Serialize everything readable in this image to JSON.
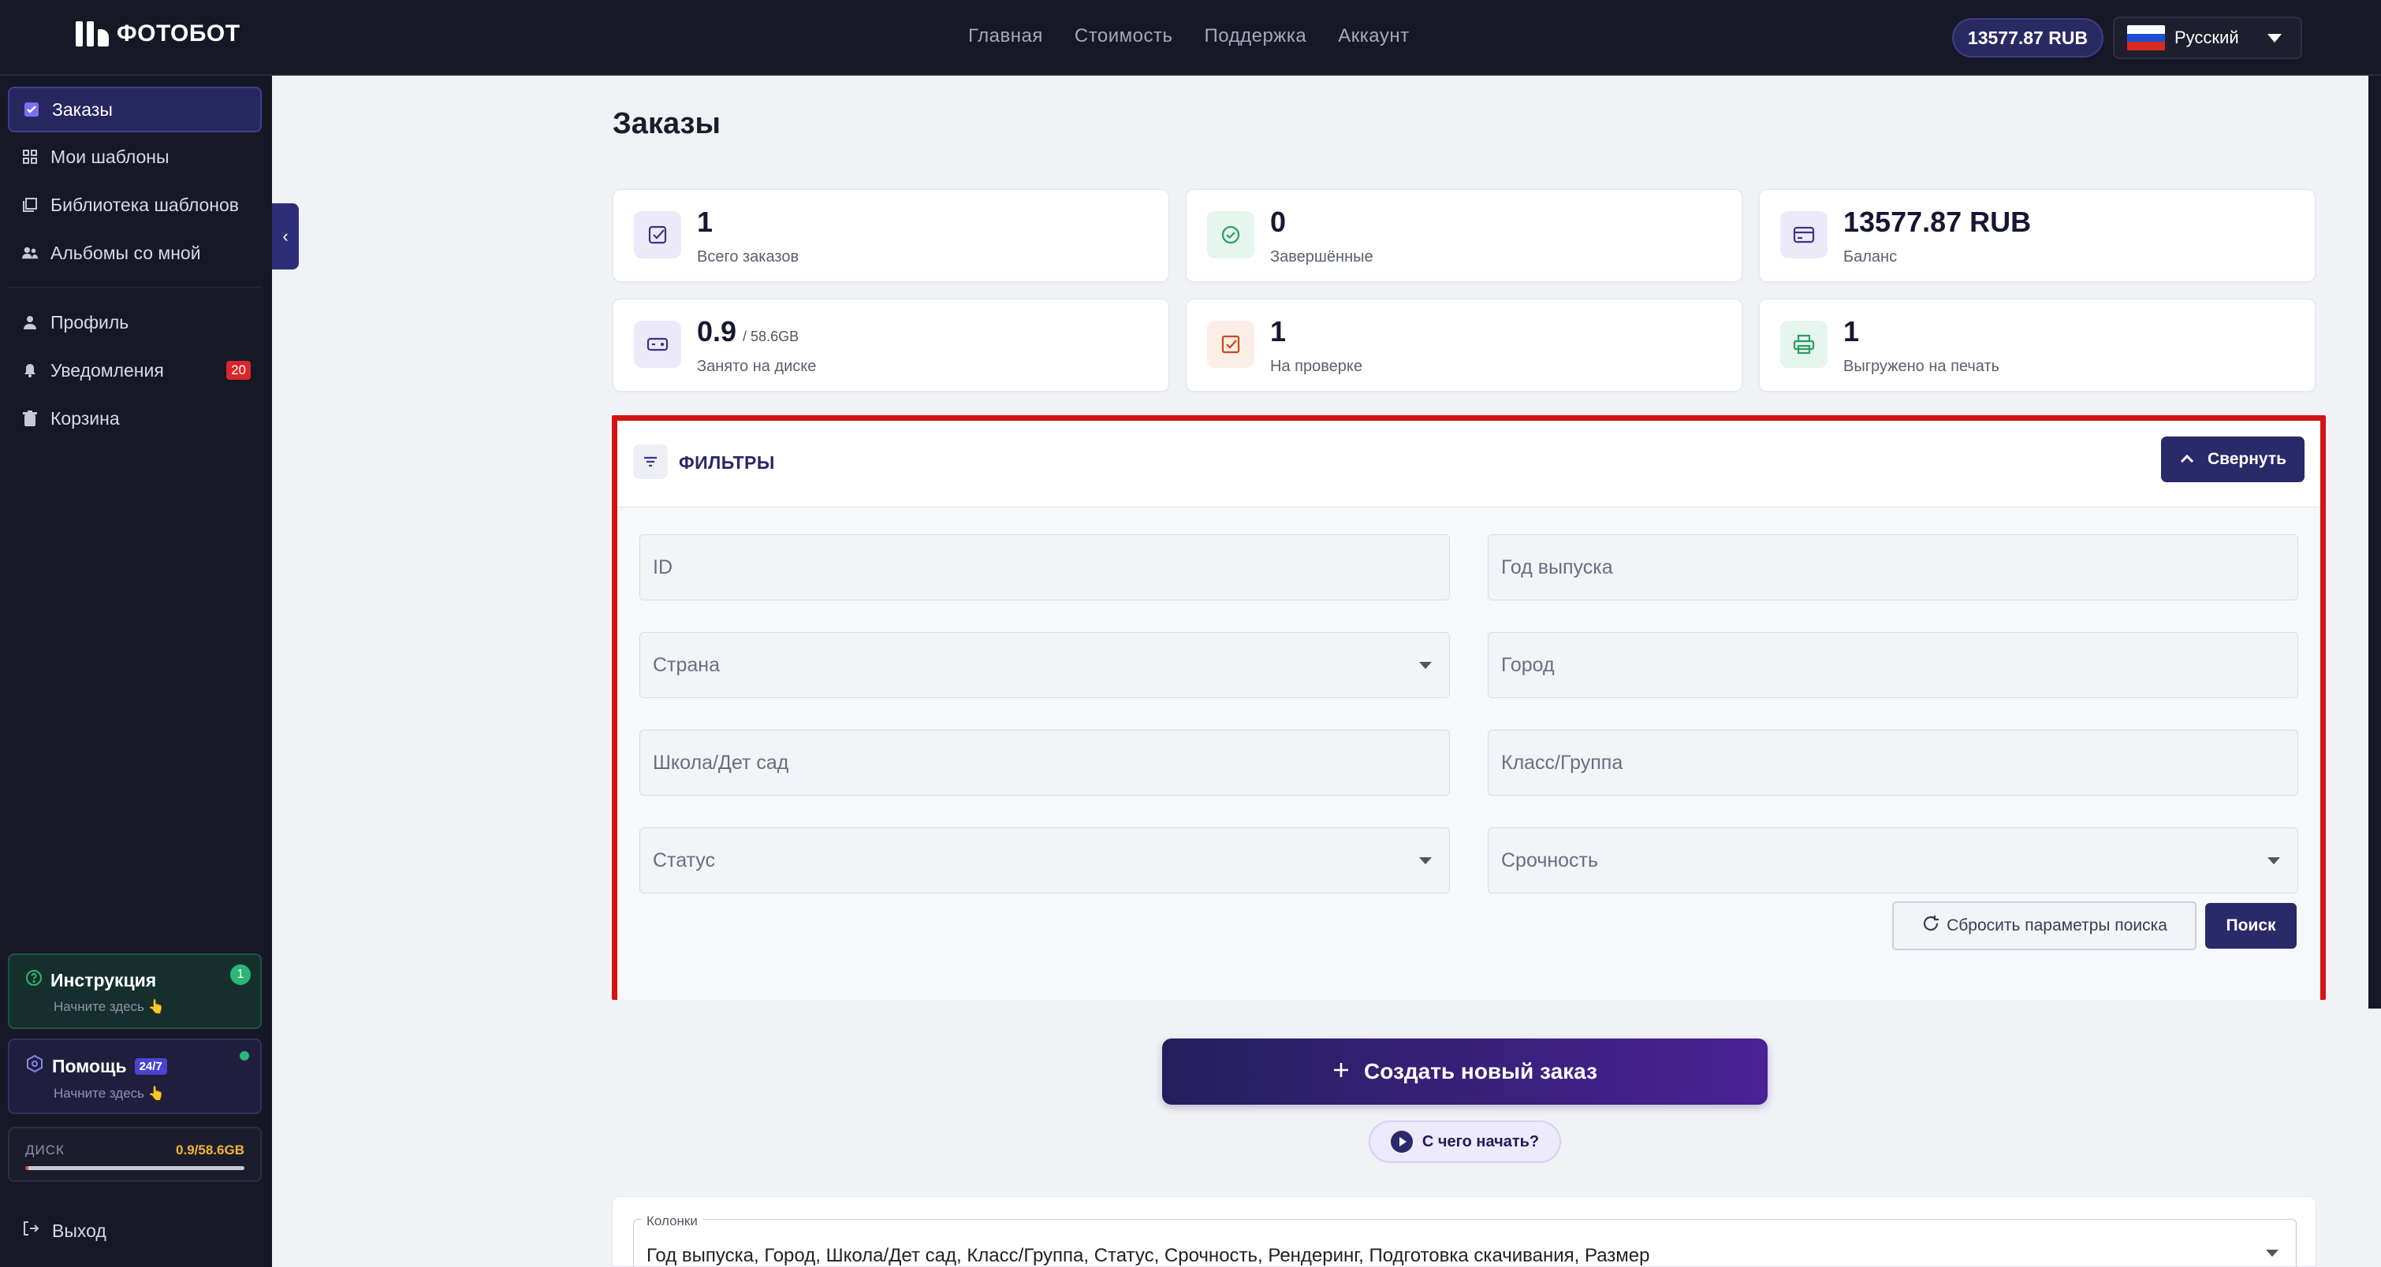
{
  "header": {
    "logo_text": "ФОТОБОТ",
    "nav": [
      "Главная",
      "Стоимость",
      "Поддержка",
      "Аккаунт"
    ],
    "balance": "13577.87 RUB",
    "language": "Русский"
  },
  "sidebar": {
    "items": [
      {
        "label": "Заказы",
        "icon": "check-square-icon"
      },
      {
        "label": "Мои шаблоны",
        "icon": "grid-icon"
      },
      {
        "label": "Библиотека шаблонов",
        "icon": "library-icon"
      },
      {
        "label": "Альбомы со мной",
        "icon": "people-icon"
      }
    ],
    "items2": [
      {
        "label": "Профиль",
        "icon": "person-icon"
      },
      {
        "label": "Уведомления",
        "icon": "bell-icon",
        "badge": "20"
      },
      {
        "label": "Корзина",
        "icon": "trash-icon"
      }
    ],
    "instruction": {
      "title": "Инструкция",
      "subtitle": "Начните здесь 👆",
      "badge": "1"
    },
    "help": {
      "title": "Помощь",
      "tag": "24/7",
      "subtitle": "Начните здесь 👆"
    },
    "disk": {
      "label": "ДИСК",
      "value": "0.9/58.6GB",
      "used_fraction": 0.015
    },
    "logout": "Выход"
  },
  "main": {
    "title": "Заказы",
    "stats": [
      {
        "value": "1",
        "label": "Всего заказов",
        "icon": "check-square-icon"
      },
      {
        "value": "0",
        "label": "Завершённые",
        "icon": "check-circle-icon"
      },
      {
        "value": "13577.87 RUB",
        "label": "Баланс",
        "icon": "card-icon"
      },
      {
        "value": "0.9",
        "extra": "/ 58.6GB",
        "label": "Занято на диске",
        "icon": "disk-icon"
      },
      {
        "value": "1",
        "label": "На проверке",
        "icon": "review-icon"
      },
      {
        "value": "1",
        "label": "Выгружено на печать",
        "icon": "printer-icon"
      }
    ],
    "filters": {
      "title": "ФИЛЬТРЫ",
      "collapse_label": "Свернуть",
      "fields": {
        "id": "ID",
        "year": "Год выпуска",
        "country": "Страна",
        "city": "Город",
        "school": "Школа/Дет сад",
        "class": "Класс/Группа",
        "status": "Статус",
        "urgency": "Срочность"
      },
      "reset_label": "Сбросить параметры поиска",
      "search_label": "Поиск"
    },
    "create_label": "Создать новый заказ",
    "start_label": "С чего начать?",
    "columns": {
      "label": "Колонки",
      "value": "Год выпуска, Город, Школа/Дет сад, Класс/Группа, Статус, Срочность, Рендеринг, Подготовка скачивания, Размер"
    }
  },
  "colors": {
    "accent": "#2a2969",
    "highlight_border": "#d41414",
    "sidebar_bg": "#171826"
  }
}
